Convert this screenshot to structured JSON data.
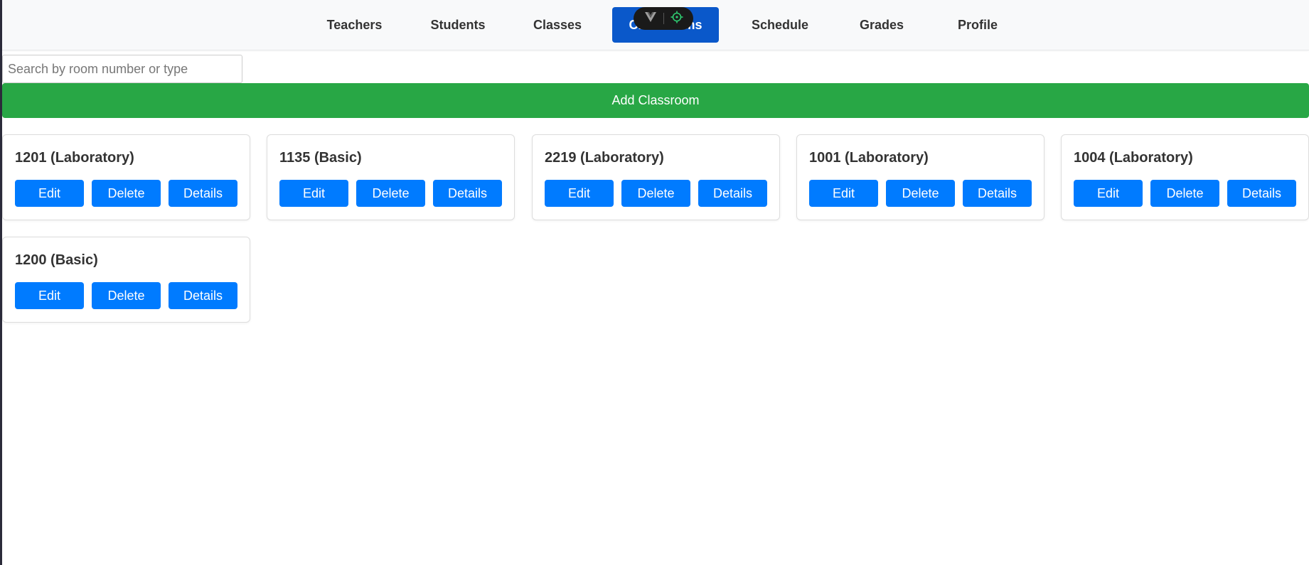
{
  "nav": {
    "items": [
      {
        "label": "Teachers"
      },
      {
        "label": "Students"
      },
      {
        "label": "Classes"
      },
      {
        "label": "Classrooms"
      },
      {
        "label": "Schedule"
      },
      {
        "label": "Grades"
      },
      {
        "label": "Profile"
      }
    ],
    "active_index": 3
  },
  "search": {
    "placeholder": "Search by room number or type",
    "value": ""
  },
  "add_button": {
    "label": "Add Classroom"
  },
  "classrooms": [
    {
      "title": "1201 (Laboratory)",
      "edit": "Edit",
      "delete": "Delete",
      "details": "Details"
    },
    {
      "title": "1135 (Basic)",
      "edit": "Edit",
      "delete": "Delete",
      "details": "Details"
    },
    {
      "title": "2219 (Laboratory)",
      "edit": "Edit",
      "delete": "Delete",
      "details": "Details"
    },
    {
      "title": "1001 (Laboratory)",
      "edit": "Edit",
      "delete": "Delete",
      "details": "Details"
    },
    {
      "title": "1004 (Laboratory)",
      "edit": "Edit",
      "delete": "Delete",
      "details": "Details"
    },
    {
      "title": "1200 (Basic)",
      "edit": "Edit",
      "delete": "Delete",
      "details": "Details"
    }
  ],
  "colors": {
    "nav_active": "#0a58ca",
    "add_button": "#28a745",
    "card_button": "#007bff"
  },
  "devtools_overlay": {
    "icons": [
      "vue-logo-icon",
      "target-icon"
    ]
  }
}
